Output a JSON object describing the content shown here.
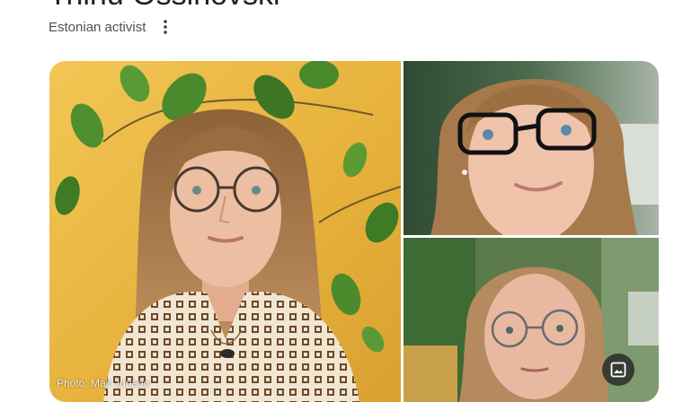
{
  "entity": {
    "title": "Triinu Ossinovski",
    "subtitle": "Estonian activist",
    "more_icon": "vertical-dots-icon"
  },
  "gallery": {
    "main_credit": "Photo: Mait Jüriado",
    "images_icon": "image-icon",
    "colors": {
      "background_wall": "#e9b53f",
      "leaf": "#4a8a2c",
      "hair": "#a7764a",
      "skin": "#e8b89c"
    }
  }
}
